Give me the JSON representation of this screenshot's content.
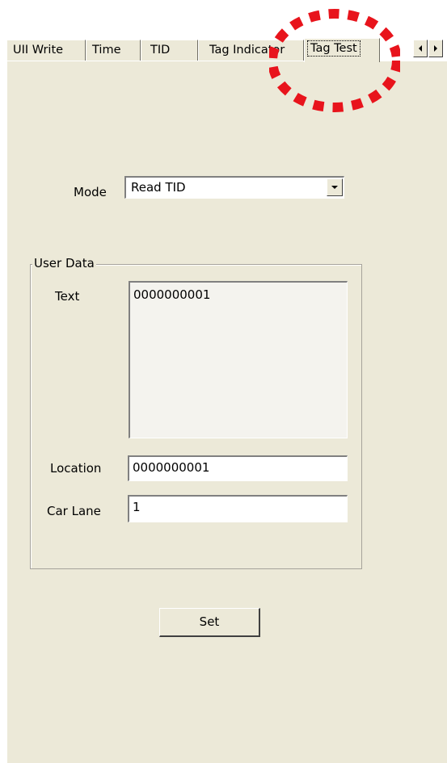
{
  "tabs": [
    {
      "label": "UII Write",
      "active": false
    },
    {
      "label": "Time",
      "active": false
    },
    {
      "label": "TID",
      "active": false
    },
    {
      "label": "Tag Indicator",
      "active": false
    },
    {
      "label": "Tag Test",
      "active": true
    }
  ],
  "mode": {
    "label": "Mode",
    "value": "Read TID"
  },
  "user_data": {
    "title": "User Data",
    "text_label": "Text",
    "text_value": "0000000001",
    "location_label": "Location",
    "location_value": "0000000001",
    "car_lane_label": "Car Lane",
    "car_lane_value": "1"
  },
  "set_button": "Set",
  "colors": {
    "panel": "#ece9d8",
    "annotation": "#e8141c"
  },
  "icons": {
    "scroll_left": "triangle-left-icon",
    "scroll_right": "triangle-right-icon",
    "combo_arrow": "chevron-down-icon",
    "highlight": "dotted-circle-annotation"
  }
}
